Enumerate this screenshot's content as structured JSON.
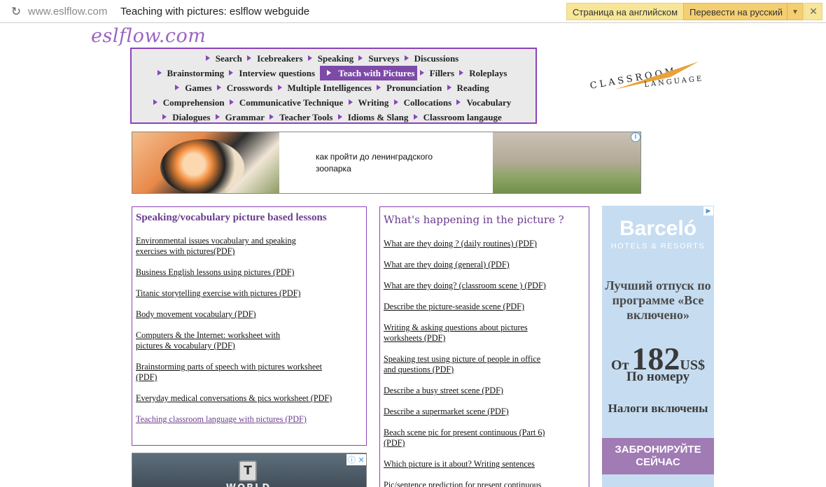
{
  "browser": {
    "domain": "www.eslflow.com",
    "title": "Teaching with pictures: eslflow webguide",
    "translate_page_label": "Страница на английском",
    "translate_to_label": "Перевести на русский"
  },
  "site": {
    "logo": "eslflow.com",
    "classroom_logo_line1": "CLASSROOM",
    "classroom_logo_line2": "LANGUAGE"
  },
  "nav": {
    "rows": [
      [
        "Search",
        "Icebreakers",
        "Speaking",
        "Surveys",
        "Discussions"
      ],
      [
        "Brainstorming",
        "Interview questions",
        "Teach with Pictures",
        "Fillers",
        "Roleplays"
      ],
      [
        "Games",
        "Crosswords",
        "Multiple Intelligences",
        "Pronunciation",
        "Reading"
      ],
      [
        "Comprehension",
        "Communicative Technique",
        "Writing",
        "Collocations",
        "Vocabulary"
      ],
      [
        "Dialogues",
        "Grammar",
        "Teacher Tools",
        "Idioms & Slang",
        "Classroom langauge"
      ]
    ],
    "active": "Teach with Pictures"
  },
  "ad_top": {
    "text": "как пройти до ленинградского зоопарка"
  },
  "left_box": {
    "title": "Speaking/vocabulary picture based  lessons",
    "links": [
      {
        "line1": "Environmental issues vocabulary and speaking",
        "line2": "exercises with pictures(PDF)"
      },
      {
        "line1": "Business English lessons using pictures (PDF)",
        "line2": ""
      },
      {
        "line1": "Titanic storytelling exercise with pictures (PDF)",
        "line2": ""
      },
      {
        "line1": "Body movement vocabulary (PDF)",
        "line2": ""
      },
      {
        "line1": "Computers & the Internet: worksheet with",
        "line2": "pictures & vocabulary (PDF)"
      },
      {
        "line1": "Brainstorming parts of speech with pictures worksheet",
        "line2": "(PDF)"
      },
      {
        "line1": "Everyday medical conversations & pics worksheet (PDF)",
        "line2": ""
      },
      {
        "line1": "Teaching classroom language with pictures (PDF)",
        "line2": ""
      }
    ]
  },
  "mid_box": {
    "title": "What's happening in the picture ?",
    "links": [
      {
        "line1": "What are they doing ? (daily routines) (PDF)",
        "line2": ""
      },
      {
        "line1": "What are they doing (general) (PDF)",
        "line2": ""
      },
      {
        "line1": "What are they doing? (classroom scene ) (PDF)",
        "line2": ""
      },
      {
        "line1": "Describe the picture-seaside scene (PDF)",
        "line2": ""
      },
      {
        "line1": "Writing & asking questions about pictures",
        "line2": "worksheets (PDF)"
      },
      {
        "line1": "Speaking test using picture of people in office",
        "line2": "and questions (PDF)"
      },
      {
        "line1": "Describe a busy street scene (PDF)",
        "line2": ""
      },
      {
        "line1": "Describe a supermarket scene (PDF)",
        "line2": ""
      },
      {
        "line1": "Beach scene pic for present continuous (Part 6)",
        "line2": "(PDF)"
      },
      {
        "line1": "Which picture is it about? Writing sentences",
        "line2": ""
      },
      {
        "line1": "Pic/sentence prediction for present continuous",
        "line2": ""
      }
    ]
  },
  "ad_right": {
    "brand": "Barceló",
    "sub": "HOTELS & RESORTS",
    "offer": "Лучший отпуск по программе «Все включено»",
    "price_from": "От",
    "price": "182",
    "currency": "US$",
    "per": "По номеру",
    "tax": "Налоги включены",
    "cta": "ЗАБРОНИРУЙТЕ СЕЙЧАС"
  }
}
